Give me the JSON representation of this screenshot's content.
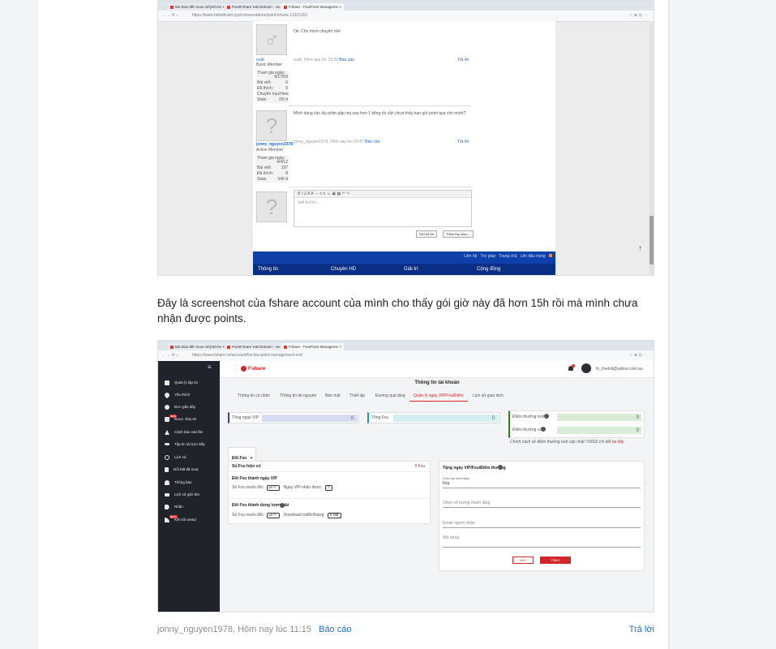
{
  "shot1": {
    "tabs": [
      "Bài Đúa đến Now rel\\(HDVie ×",
      "PointFshare \\HDVietnam - Hu ×",
      "Fshare - Fea/Point Manageme ×"
    ],
    "address": "https://www.hdvietnam.xyz/conversations/point-fshare.11323.62/",
    "posts": [
      {
        "message": "Ok. Cho mình chuyển nhé",
        "username": "roxE",
        "role": "Basic Member",
        "stats": [
          "Tham gia ngày:",
          "8/17/09",
          "Bài viết:",
          "6",
          "Đã thích:",
          "0",
          "Chuyên mục",
          "Here",
          "Stats",
          "2/5 tt"
        ],
        "footer_meta": "roxE, Hôm qua lúc 19:29",
        "report": "Báo cáo",
        "reply": "Trả lời",
        "avatar_glyph": "♂"
      },
      {
        "message": "Mình đang cần lấy phim gấp mà sao hơn 1 tiếng rồi vẫn chưa thấy bạn gửi point qua cho mình?",
        "username": "jonny_nguyen1978",
        "role": "Active Member",
        "stats": [
          "Tham gia ngày:",
          "4/4/12",
          "Bài viết:",
          "197",
          "Đã thích:",
          "8",
          "Stats",
          "540 tt"
        ],
        "footer_meta": "jonny_nguyen1978, Hôm nay lúc 10:47",
        "report": "Báo cáo",
        "reply": "Trả lời",
        "avatar_glyph": "?"
      }
    ],
    "editor_placeholder": "Viết trả lời...",
    "reply_avatar_glyph": "?",
    "buttons": {
      "send": "Gửi trả lời",
      "more": "Thêm tùy chọn..."
    },
    "footer_links": [
      "Liên hệ",
      "Trợ giúp",
      "Trang chủ",
      "Lên đầu trang"
    ],
    "footer_nav": [
      "Thông tin",
      "Chuyên HD",
      "Giải trí",
      "Cộng đồng"
    ],
    "scroll_top_icon": "↑"
  },
  "paragraph": "Đây là screenshot của fshare account của mình cho thấy gói giờ này đã hơn 15h rồi mà mình chưa nhận được points.",
  "shot2": {
    "tabs": [
      "Bài Đúa đến Now rel\\(HDVie ×",
      "PointFshare \\HDVietnam - Hu ×",
      "Fshare - Fea/Point Manageme ×"
    ],
    "address": "https://www.fshare.vn/account/fsx-fea-point-management-vnd",
    "brand": "Fshare",
    "user_email": "fx_chetsit@yahoo.com.au",
    "sidebar": [
      {
        "label": "Quản lý tập tin",
        "icon": "folder-icon"
      },
      {
        "label": "Yêu thích",
        "icon": "heart-icon"
      },
      {
        "label": "Đơn gần đây",
        "icon": "clock-icon"
      },
      {
        "label": "Được chia sẻ",
        "icon": "users-icon",
        "badge": "NEW"
      },
      {
        "label": "Cảnh báo vari file",
        "icon": "warning-icon"
      },
      {
        "label": "Tập tin tài trực tiếp",
        "icon": "link-icon"
      },
      {
        "label": "Lịch sử",
        "icon": "history-icon"
      },
      {
        "label": "Đổi Mã đã mua",
        "icon": "file-icon"
      },
      {
        "label": "Thông báo",
        "icon": "bell-icon"
      },
      {
        "label": "Lịch sử giới tên",
        "icon": "list-icon"
      },
      {
        "label": "Nhãn",
        "icon": "tag-icon"
      },
      {
        "label": "Kết nối viewd",
        "icon": "rss-icon",
        "badge": "BETA"
      }
    ],
    "section_title": "Thông tin tài khoản",
    "subtabs": [
      "Thông tin cá nhân",
      "Thông tin tài nguyên",
      "Bảo mật",
      "Thiết lập",
      "Đường quà tặng",
      "Quản lý ngày VIP/Fxu/Điểm",
      "Lịch sử giao dịch"
    ],
    "active_subtab": 5,
    "stats": {
      "vip_label": "Tổng ngày VIP",
      "vip_value": "0",
      "fxu_label": "Tổng Fxu",
      "fxu_value": "0",
      "points_reward_label": "Điểm thưởng mới",
      "points_reward_value": "0",
      "points_old_label": "Điểm thưởng cũ",
      "points_old_value": "0",
      "policy_text": "Chính sách về điểm thưởng mới cập nhật 7/2022 chi tiết",
      "policy_link": "tại đây"
    },
    "exchange_dropdown": "Đổi Fxu",
    "exchange_panel": {
      "title": "Số Fxu hiện có",
      "fxu_count": "0 Fxu",
      "vip_heading": "Đổi Fxu thành ngày VIP",
      "vip_field_label": "Số Fxu muốn đổi:",
      "vip_field_value": "0",
      "vip_result_label": "Ngày VIP nhận được:",
      "vip_result_value": "0",
      "bw_heading": "Đổi Fxu thành dung lượng tải",
      "bw_field_label": "Số Fxu muốn đổi:",
      "bw_field_value": "0",
      "bw_result_label": "Download traffic/tháng:",
      "bw_result_value": "0 GB"
    },
    "gift_panel": {
      "title": "Tặng ngày VIP/Fxu/Điểm thưởng",
      "type_label": "Chọn loại muốn tặng",
      "type_value": "Fxu",
      "amount_placeholder": "Chọn số lượng muốn tặng",
      "email_placeholder": "Email người nhận",
      "content_placeholder": "Nội dung",
      "cancel": "HỦY",
      "submit": "TẶNG"
    },
    "accent": "#d0272a"
  },
  "post_meta": {
    "author_time": "jonny_nguyen1978, Hôm nay lúc 11:15",
    "report": "Báo cáo",
    "reply": "Trả lời"
  }
}
